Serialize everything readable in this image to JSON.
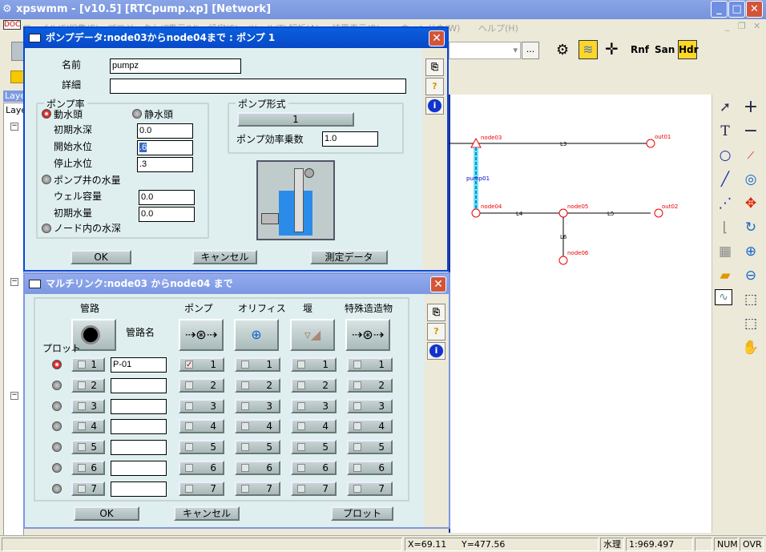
{
  "window": {
    "title": "xpswmm - [v10.5] [RTCpump.xp] [Network]"
  },
  "menu": [
    "ファイル(F)",
    "編集(E)",
    "プロジェクト(P)",
    "表示(V)",
    "設定(S)",
    "ツール(T)",
    "解析(A)",
    "結果表示(R)",
    "ウィンドウ(W)",
    "ヘルプ(H)"
  ],
  "toolbar": {
    "browse_label": "...",
    "rnf": "Rnf",
    "san": "San",
    "hdr": "Hdr"
  },
  "layer_panel": {
    "title": "Laye",
    "header": "Laye"
  },
  "network": {
    "nodes": [
      "node03",
      "out01",
      "node04",
      "node05",
      "out02",
      "node06"
    ],
    "links": [
      "L3",
      "L4",
      "L5",
      "L6"
    ],
    "pump": "pump01"
  },
  "pump_dialog": {
    "title": "ポンプデータ:node03からnode04まで : ポンプ 1",
    "name_label": "名前",
    "name_value": "pumpz",
    "detail_label": "詳細",
    "detail_value": "",
    "rate_group": "ポンプ率",
    "dynamic_head": "動水頭",
    "static_head": "静水頭",
    "initial_depth_label": "初期水深",
    "initial_depth": "0.0",
    "start_level_label": "開始水位",
    "start_level": ".6",
    "stop_level_label": "停止水位",
    "stop_level": ".3",
    "wet_well_label": "ポンプ井の水量",
    "well_capacity_label": "ウェル容量",
    "well_capacity": "0.0",
    "initial_volume_label": "初期水量",
    "initial_volume": "0.0",
    "node_depth_label": "ノード内の水深",
    "type_group": "ポンプ形式",
    "type_value": "1",
    "efficiency_label": "ポンプ効率乗数",
    "efficiency": "1.0",
    "ok": "OK",
    "cancel": "キャンセル",
    "measured": "測定データ",
    "selected_mode": "動水頭"
  },
  "multilink_dialog": {
    "title": "マルチリンク:node03 からnode04 まで",
    "col_pipe": "管路",
    "col_pump": "ポンプ",
    "col_orifice": "オリフィス",
    "col_weir": "堰",
    "col_special": "特殊造造物",
    "pipe_name_label": "管路名",
    "plot_label": "プロット",
    "rows": [
      {
        "n": "1",
        "pipe_name": "P-01",
        "pump_checked": true,
        "selected": true
      },
      {
        "n": "2",
        "pipe_name": "",
        "pump_checked": false,
        "selected": false
      },
      {
        "n": "3",
        "pipe_name": "",
        "pump_checked": false,
        "selected": false
      },
      {
        "n": "4",
        "pipe_name": "",
        "pump_checked": false,
        "selected": false
      },
      {
        "n": "5",
        "pipe_name": "",
        "pump_checked": false,
        "selected": false
      },
      {
        "n": "6",
        "pipe_name": "",
        "pump_checked": false,
        "selected": false
      },
      {
        "n": "7",
        "pipe_name": "",
        "pump_checked": false,
        "selected": false
      }
    ],
    "ok": "OK",
    "cancel": "キャンセル",
    "plot": "プロット"
  },
  "status": {
    "x": "X=69.11",
    "y": "Y=477.56",
    "mode": "水理",
    "scale": "1:969.497",
    "num": "NUM",
    "ovr": "OVR"
  }
}
